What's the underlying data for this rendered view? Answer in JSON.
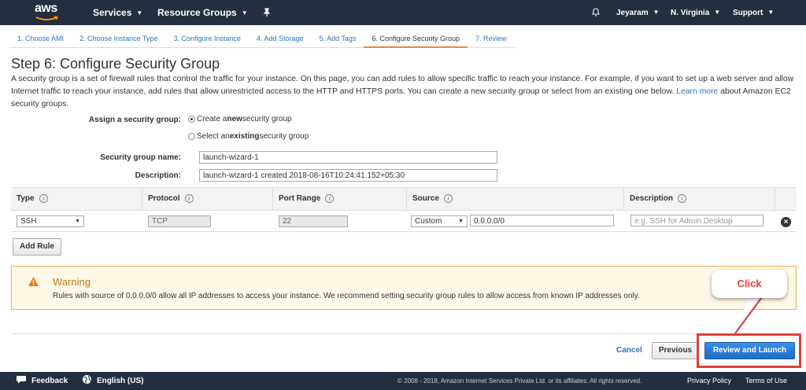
{
  "nav": {
    "logo": "aws",
    "services": "Services",
    "resource_groups": "Resource Groups",
    "user": "Jeyaram",
    "region": "N. Virginia",
    "support": "Support"
  },
  "steps": [
    {
      "label": "1. Choose AMI",
      "active": false
    },
    {
      "label": "2. Choose Instance Type",
      "active": false
    },
    {
      "label": "3. Configure Instance",
      "active": false
    },
    {
      "label": "4. Add Storage",
      "active": false
    },
    {
      "label": "5. Add Tags",
      "active": false
    },
    {
      "label": "6. Configure Security Group",
      "active": true
    },
    {
      "label": "7. Review",
      "active": false
    }
  ],
  "page": {
    "title": "Step 6: Configure Security Group",
    "intro": "A security group is a set of firewall rules that control the traffic for your instance. On this page, you can add rules to allow specific traffic to reach your instance. For example, if you want to set up a web server and allow Internet traffic to reach your instance, add rules that allow unrestricted access to the HTTP and HTTPS ports. You can create a new security group or select from an existing one below.",
    "learn_more": "Learn more",
    "intro_tail": " about Amazon EC2 security groups."
  },
  "form": {
    "assign_label": "Assign a security group:",
    "opt_new_pre": "Create a ",
    "opt_new_bold": "new",
    "opt_new_post": " security group",
    "opt_existing_pre": "Select an ",
    "opt_existing_bold": "existing",
    "opt_existing_post": " security group",
    "name_label": "Security group name:",
    "name_value": "launch-wizard-1",
    "desc_label": "Description:",
    "desc_value": "launch-wizard-1 created 2018-08-16T10:24:41.152+05:30"
  },
  "table": {
    "headers": [
      "Type",
      "Protocol",
      "Port Range",
      "Source",
      "Description"
    ],
    "info_glyph": "i",
    "row": {
      "type": "SSH",
      "protocol": "TCP",
      "port": "22",
      "source_mode": "Custom",
      "source_cidr": "0.0.0.0/0",
      "desc_placeholder": "e.g. SSH for Admin Desktop"
    },
    "add_rule": "Add Rule"
  },
  "warning": {
    "title": "Warning",
    "message": "Rules with source of 0.0.0.0/0 allow all IP addresses to access your instance. We recommend setting security group rules to allow access from known IP addresses only."
  },
  "actions": {
    "cancel": "Cancel",
    "previous": "Previous",
    "review_launch": "Review and Launch"
  },
  "annotation": {
    "callout": "Click",
    "color": "#e0403a"
  },
  "footer": {
    "feedback": "Feedback",
    "language": "English (US)",
    "copyright": "© 2008 - 2018, Amazon Internet Services Private Ltd. or its affiliates. All rights reserved.",
    "privacy": "Privacy Policy",
    "terms": "Terms of Use"
  }
}
